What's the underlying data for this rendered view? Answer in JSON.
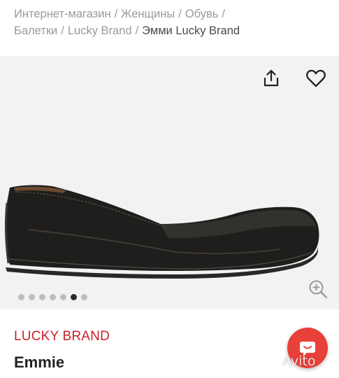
{
  "breadcrumb": {
    "items": [
      "Интернет-магазин",
      "Женщины",
      "Обувь",
      "Балетки",
      "Lucky Brand"
    ],
    "current": "Эмми Lucky Brand",
    "separator": "/"
  },
  "gallery": {
    "image_count": 7,
    "active_index": 5,
    "icons": {
      "share": "share-icon",
      "favorite": "heart-icon",
      "zoom": "zoom-in-icon"
    }
  },
  "product": {
    "brand": "LUCKY BRAND",
    "title": "Emmie"
  },
  "chat_button": {
    "icon": "chat-icon",
    "color": "#e8413a"
  },
  "watermark": {
    "text": "Avito"
  },
  "colors": {
    "brand_red": "#c8232c",
    "breadcrumb_gray": "#9a9a9a",
    "gallery_bg": "#f2f2f2"
  }
}
